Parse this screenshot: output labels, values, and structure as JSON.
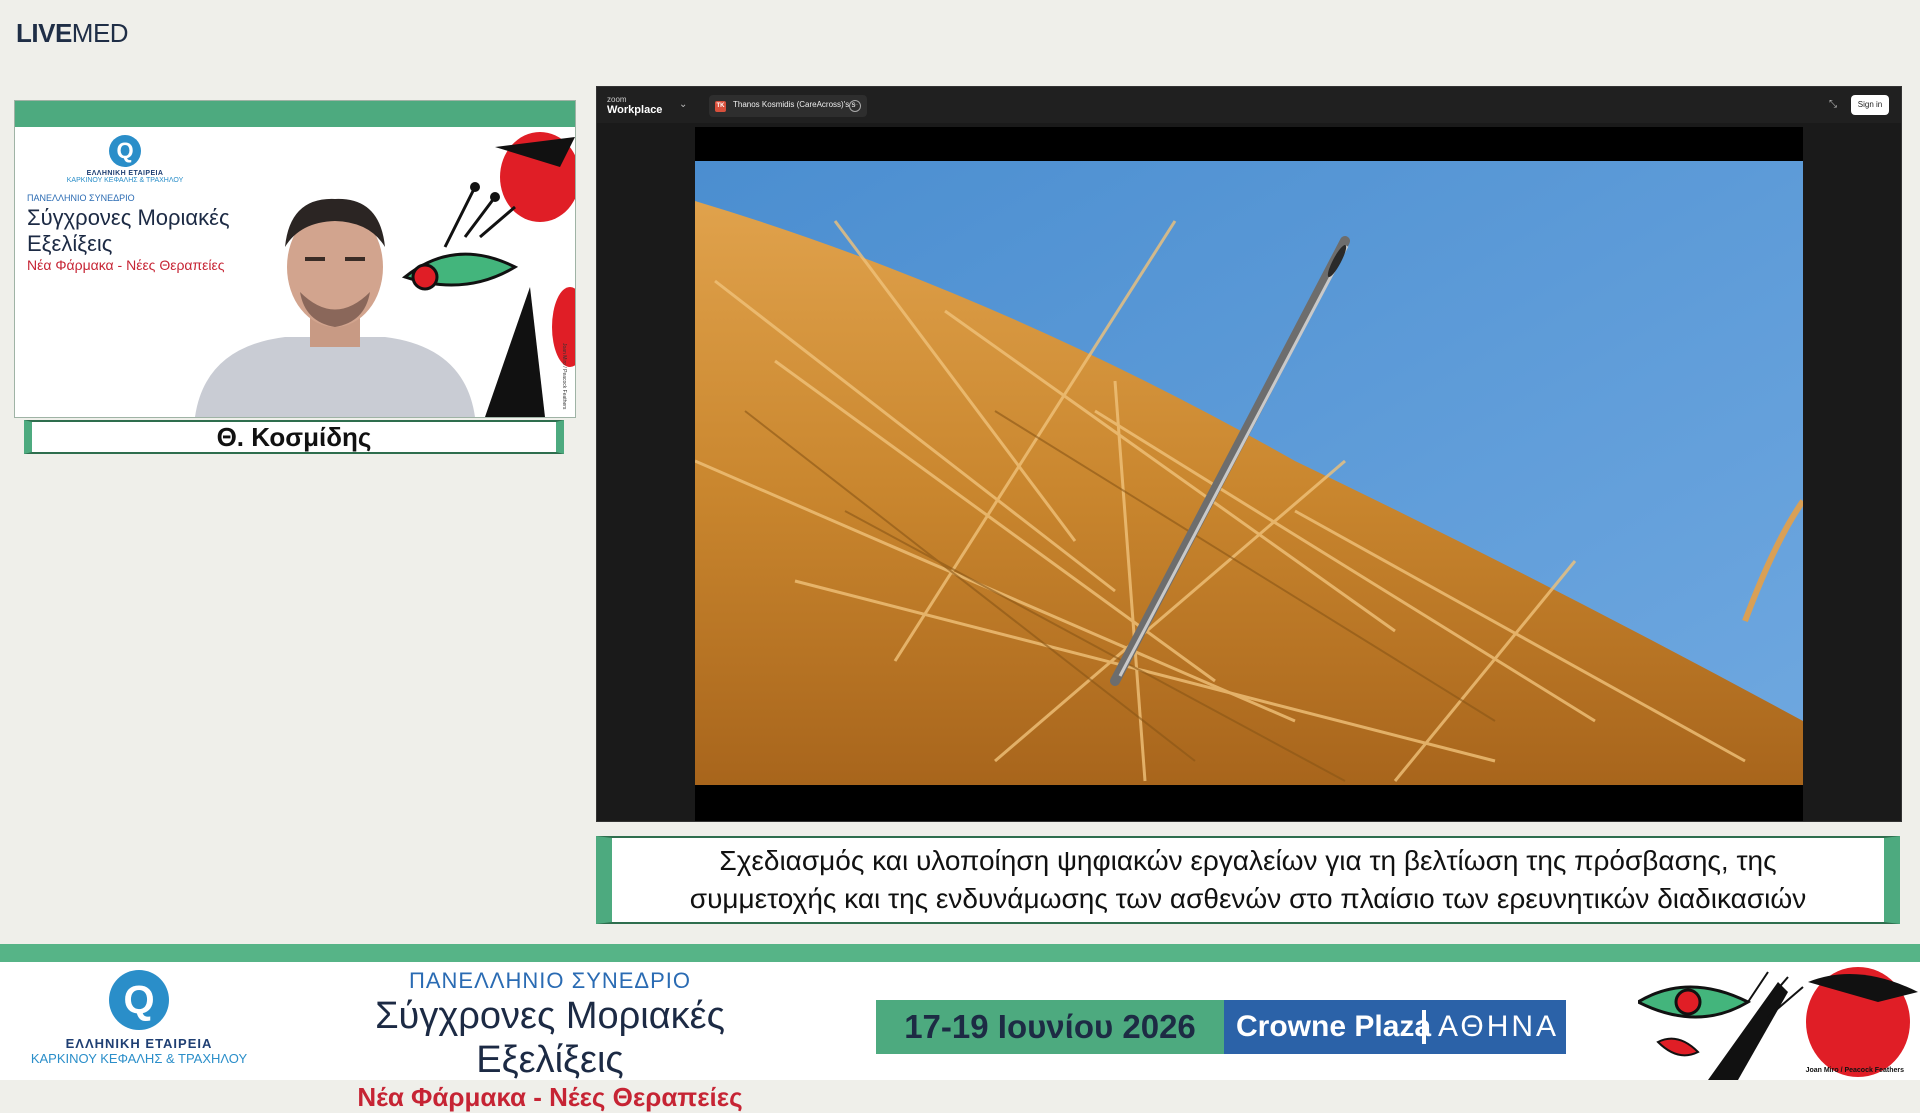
{
  "brand": {
    "live": "LIVE",
    "med": "MED"
  },
  "speaker_panel": {
    "society_line1": "ΕΛΛΗΝΙΚΗ ΕΤΑΙΡΕΙΑ",
    "society_line2": "ΚΑΡΚΙΝΟΥ ΚΕΦΑΛΗΣ & ΤΡΑΧΗΛΟΥ",
    "conference_label": "ΠΑΝΕΛΛΗΝΙΟ ΣΥΝΕΔΡΙΟ",
    "title": "Σύγχρονες Μοριακές Εξελίξεις",
    "subtitle": "Νέα Φάρμακα - Νέες Θεραπείες"
  },
  "speaker_name": "Θ. Κοσμίδης",
  "zoom": {
    "brand_small": "zoom",
    "brand_name": "Workplace",
    "tab_initials": "TK",
    "tab_title": "Thanos Kosmidis (CareAcross)'s s",
    "signin_label": "Sign in"
  },
  "caption": {
    "line1": "Σχεδιασμός και υλοποίηση ψηφιακών εργαλείων για τη βελτίωση της πρόσβασης, της",
    "line2": "συμμετοχής και της ενδυνάμωσης των ασθενών στο πλαίσιο των ερευνητικών διαδικασιών"
  },
  "footer": {
    "society_line1": "ΕΛΛΗΝΙΚΗ ΕΤΑΙΡΕΙΑ",
    "society_line2": "ΚΑΡΚΙΝΟΥ ΚΕΦΑΛΗΣ & ΤΡΑΧΗΛΟΥ",
    "conference_label": "ΠΑΝΕΛΛΗΝΙΟ ΣΥΝΕΔΡΙΟ",
    "title": "Σύγχρονες Μοριακές Εξελίξεις",
    "subtitle": "Νέα Φάρμακα - Νέες Θεραπείες",
    "dates": "17-19 Ιουνίου 2026",
    "hotel": "Crowne Plaza",
    "city": "ΑΘΗΝΑ",
    "art_credit": "Joan Miro / Peacock Feathers"
  },
  "colors": {
    "accent_green": "#4daa7f",
    "brand_blue": "#2a8ec9",
    "title_navy": "#1c2a44",
    "accent_red": "#c62434",
    "venue_blue": "#2b62a8"
  }
}
